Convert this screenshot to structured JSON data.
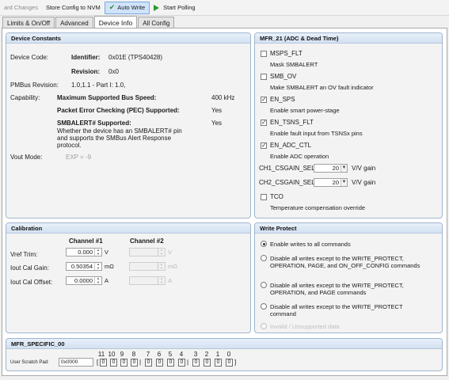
{
  "toolbar": {
    "discard_label": "ard Changes",
    "store_label": "Store Config to NVM",
    "auto_write_label": "Auto Write",
    "start_polling_label": "Start Polling"
  },
  "tabs": [
    "Limits & On/Off",
    "Advanced",
    "Device Info",
    "All Config"
  ],
  "device_constants": {
    "title": "Device Constants",
    "device_code_label": "Device Code:",
    "identifier_label": "Identifier:",
    "identifier_value": "0x01E (TPS40428)",
    "revision_label": "Revision:",
    "revision_value": "0x0",
    "pmbus_revision_label": "PMBus Revision:",
    "pmbus_revision_value": "1.0,1.1 - Part I: 1.0,",
    "capability_label": "Capability:",
    "max_bus_speed_label": "Maximum Supported Bus Speed:",
    "max_bus_speed_value": "400 kHz",
    "pec_label": "Packet Error Checking (PEC) Supported:",
    "pec_value": "Yes",
    "smbalert_label": "SMBALERT# Supported:",
    "smbalert_value": "Yes",
    "smbalert_desc_1": "Whether the device has an SMBALERT# pin",
    "smbalert_desc_2": "and supports the SMBus Alert Response",
    "smbalert_desc_3": "protocol.",
    "vout_mode_label": "Vout Mode:",
    "vout_mode_value": "EXP = -9"
  },
  "mfr21": {
    "title": "MFR_21 (ADC & Dead Time)",
    "items": [
      {
        "label": "MSPS_FLT",
        "desc": "Mask SMBALERT",
        "checked": false
      },
      {
        "label": "SMB_OV",
        "desc": "Make SMBALERT an OV fault indicator",
        "checked": false
      },
      {
        "label": "EN_SPS",
        "desc": "Enable smart power-stage",
        "checked": true
      },
      {
        "label": "EN_TSNS_FLT",
        "desc": "Enable fault input from TSNSx pins",
        "checked": true
      },
      {
        "label": "EN_ADC_CTL",
        "desc": "Enable ADC operation",
        "checked": true
      }
    ],
    "ch1_label": "CH1_CSGAIN_SEL:",
    "ch1_value": "20",
    "ch1_unit": "V/V gain",
    "ch2_label": "CH2_CSGAIN_SEL:",
    "ch2_value": "20",
    "ch2_unit": "V/V gain",
    "tco_label": "TCO",
    "tco_desc": "Temperature compensation override",
    "tco_checked": false
  },
  "calibration": {
    "title": "Calibration",
    "channel1_header": "Channel #1",
    "channel2_header": "Channel #2",
    "rows": [
      {
        "label": "Vref Trim:",
        "ch1": "0.000",
        "ch2": "",
        "unit": "V"
      },
      {
        "label": "Iout Cal Gain:",
        "ch1": "0.50354",
        "ch2": "",
        "unit": "mΩ"
      },
      {
        "label": "Iout Cal Offset:",
        "ch1": "0.0000",
        "ch2": "",
        "unit": "A"
      }
    ]
  },
  "write_protect": {
    "title": "Write Protect",
    "options": [
      {
        "line1": "Enable writes to all commands",
        "line2": "",
        "selected": true
      },
      {
        "line1": "Disable all writes except to the WRITE_PROTECT,",
        "line2": "OPERATION, PAGE, and ON_OFF_CONFIG commands",
        "selected": false
      },
      {
        "line1": "Disable all writes except to the WRITE_PROTECT,",
        "line2": "OPERATION, and PAGE commands",
        "selected": false
      },
      {
        "line1": "Disable all writes except to the WRITE_PROTECT",
        "line2": "command",
        "selected": false
      },
      {
        "line1": "Invalid / Unsupported data",
        "line2": "",
        "selected": false
      }
    ]
  },
  "mfr_specific": {
    "title": "MFR_SPECIFIC_00",
    "scratch_label": "User Scratch Pad:",
    "scratch_value": "0x0000",
    "bits": [
      "11",
      "10",
      "9",
      "8",
      "7",
      "6",
      "5",
      "4",
      "3",
      "2",
      "1",
      "0"
    ],
    "bit_values": [
      "0",
      "0",
      "0",
      "0",
      "0",
      "0",
      "0",
      "0",
      "0",
      "0",
      "0",
      "0"
    ]
  }
}
